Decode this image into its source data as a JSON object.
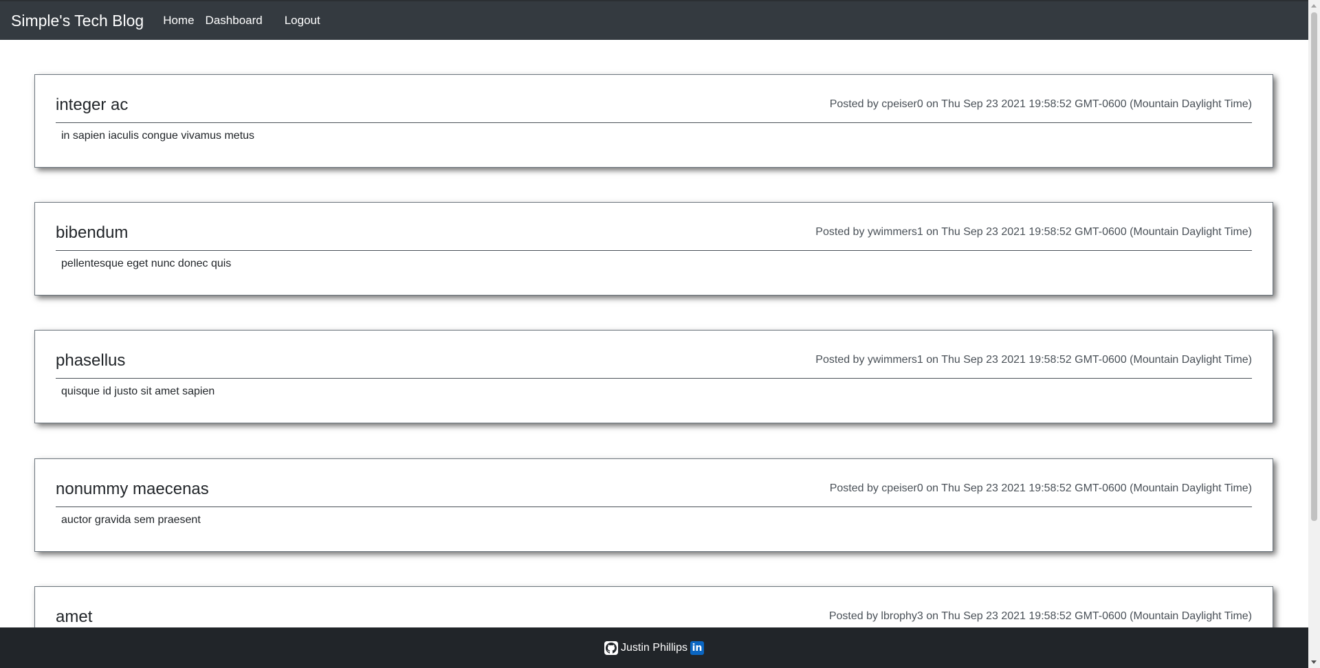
{
  "navbar": {
    "brand": "Simple's Tech Blog",
    "links": [
      "Home",
      "Dashboard",
      "Logout"
    ]
  },
  "posts": [
    {
      "title": "integer ac",
      "meta": "Posted by cpeiser0 on Thu Sep 23 2021 19:58:52 GMT-0600 (Mountain Daylight Time)",
      "body": "in sapien iaculis congue vivamus metus"
    },
    {
      "title": "bibendum",
      "meta": "Posted by ywimmers1 on Thu Sep 23 2021 19:58:52 GMT-0600 (Mountain Daylight Time)",
      "body": "pellentesque eget nunc donec quis"
    },
    {
      "title": "phasellus",
      "meta": "Posted by ywimmers1 on Thu Sep 23 2021 19:58:52 GMT-0600 (Mountain Daylight Time)",
      "body": "quisque id justo sit amet sapien"
    },
    {
      "title": "nonummy maecenas",
      "meta": "Posted by cpeiser0 on Thu Sep 23 2021 19:58:52 GMT-0600 (Mountain Daylight Time)",
      "body": "auctor gravida sem praesent"
    },
    {
      "title": "amet",
      "meta": "Posted by lbrophy3 on Thu Sep 23 2021 19:58:52 GMT-0600 (Mountain Daylight Time)",
      "body": ""
    }
  ],
  "footer": {
    "author": "Justin Phillips",
    "linkedin_glyph": "in",
    "icons": [
      "github-icon",
      "linkedin-icon"
    ]
  },
  "colors": {
    "navbar_bg": "#343a40",
    "footer_bg": "#212529",
    "linkedin": "#0a66c2"
  }
}
